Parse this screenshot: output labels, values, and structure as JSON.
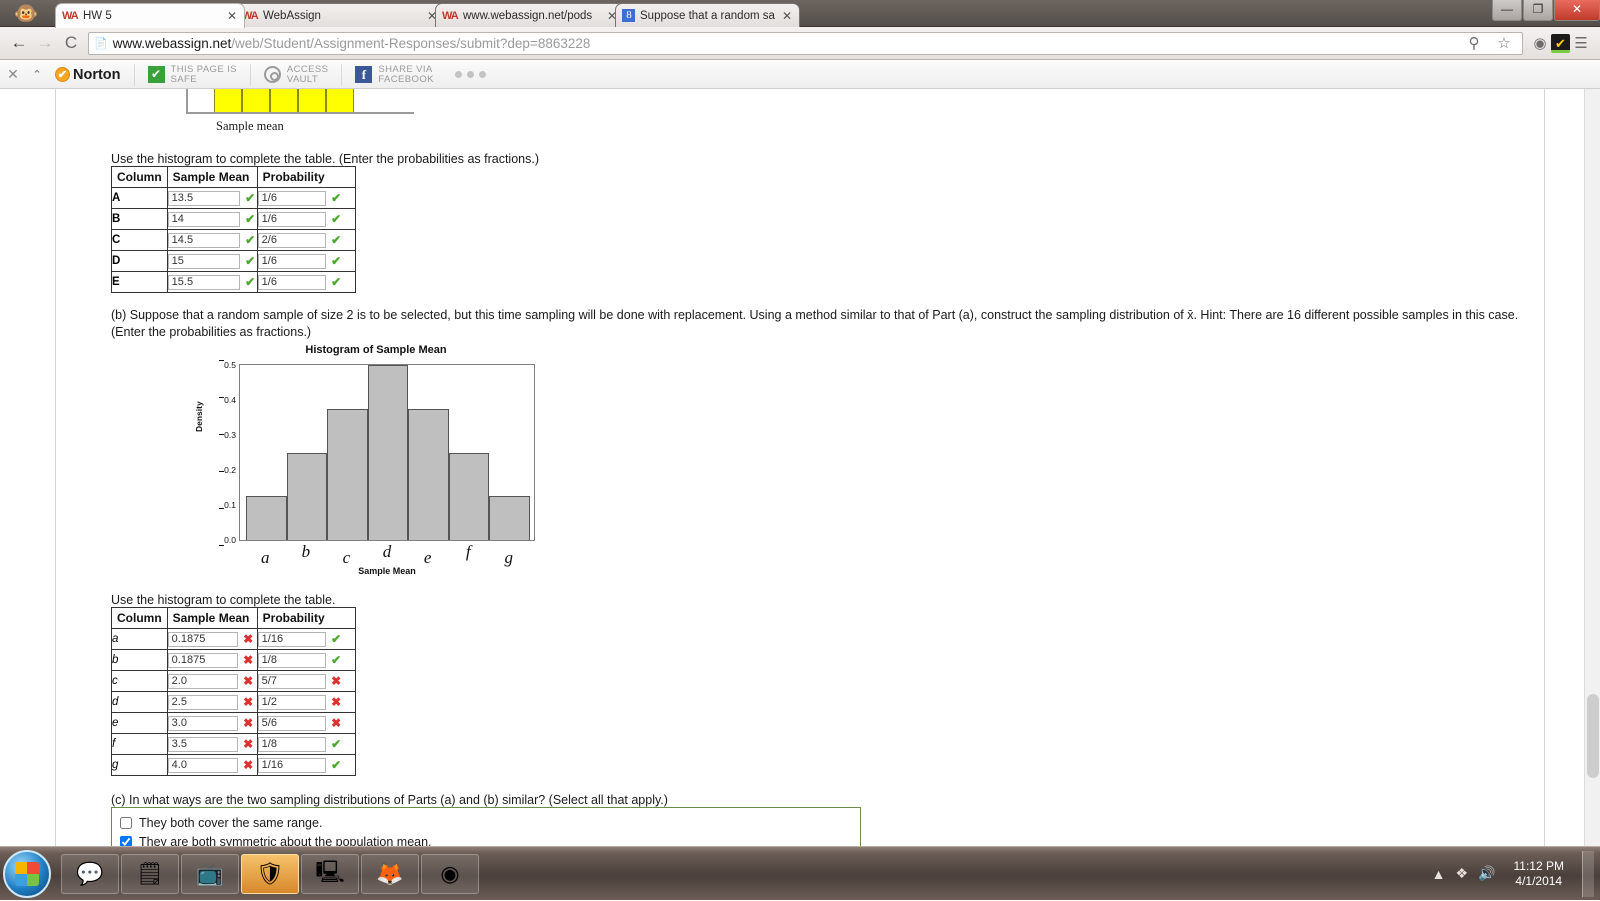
{
  "browser": {
    "logo_icon": "monkey-logo",
    "tabs": [
      {
        "title": "HW 5",
        "favicon": "webassign-icon",
        "active": true
      },
      {
        "title": "WebAssign",
        "favicon": "webassign-icon",
        "active": false
      },
      {
        "title": "www.webassign.net/pods",
        "favicon": "webassign-icon",
        "active": false
      },
      {
        "title": "Suppose that a random sa",
        "favicon": "google-icon",
        "active": false
      }
    ],
    "tab_close_label": "✕",
    "window_controls": {
      "minimize": "—",
      "maximize": "❐",
      "close": "✕"
    },
    "nav": {
      "back": "←",
      "forward": "→",
      "reload": "C"
    },
    "omnibox": {
      "page_icon": "page-icon",
      "url_domain": "www.webassign.net",
      "url_path": "/web/Student/Assignment-Responses/submit?dep=8863228"
    },
    "omnibox_icons": {
      "zoom": "⚲",
      "bookmark": "☆"
    },
    "toolbar_icons": {
      "extension": "◉",
      "norton_badge": "✔",
      "menu": "☰"
    }
  },
  "norton_bar": {
    "close_icon": "✕",
    "collapse_icon": "⌃",
    "brand": "Norton",
    "brand_check": "✔",
    "items": [
      {
        "icon": "green-check-icon",
        "glyph": "✔",
        "line1": "THIS PAGE IS",
        "line2": "SAFE"
      },
      {
        "icon": "vault-icon",
        "glyph": "",
        "line1": "ACCESS",
        "line2": "VAULT"
      },
      {
        "icon": "facebook-icon",
        "glyph": "f",
        "line1": "SHARE VIA",
        "line2": "FACEBOOK"
      }
    ]
  },
  "top_histogram": {
    "caption": "Sample mean",
    "bar_count": 5,
    "color": "#ffff00"
  },
  "part_a": {
    "instruction": "Use the histogram to complete the table. (Enter the probabilities as fractions.)",
    "headers": [
      "Column",
      "Sample Mean",
      "Probability"
    ],
    "rows": [
      {
        "column": "A",
        "sample_mean": "13.5",
        "mean_status": "correct",
        "probability": "1/6",
        "prob_status": "correct"
      },
      {
        "column": "B",
        "sample_mean": "14",
        "mean_status": "correct",
        "probability": "1/6",
        "prob_status": "correct"
      },
      {
        "column": "C",
        "sample_mean": "14.5",
        "mean_status": "correct",
        "probability": "2/6",
        "prob_status": "correct"
      },
      {
        "column": "D",
        "sample_mean": "15",
        "mean_status": "correct",
        "probability": "1/6",
        "prob_status": "correct"
      },
      {
        "column": "E",
        "sample_mean": "15.5",
        "mean_status": "correct",
        "probability": "1/6",
        "prob_status": "correct"
      }
    ]
  },
  "part_b": {
    "text": "(b) Suppose that a random sample of size 2 is to be selected, but this time sampling will be done with replacement. Using a method similar to that of Part (a), construct the sampling distribution of x̄. Hint: There are 16 different possible samples in this case. (Enter the probabilities as fractions.)",
    "instruction": "Use the histogram to complete the table.",
    "headers": [
      "Column",
      "Sample Mean",
      "Probability"
    ],
    "rows": [
      {
        "column": "a",
        "sample_mean": "0.1875",
        "mean_status": "incorrect",
        "probability": "1/16",
        "prob_status": "correct"
      },
      {
        "column": "b",
        "sample_mean": "0.1875",
        "mean_status": "incorrect",
        "probability": "1/8",
        "prob_status": "correct"
      },
      {
        "column": "c",
        "sample_mean": "2.0",
        "mean_status": "incorrect",
        "probability": "5/7",
        "prob_status": "incorrect"
      },
      {
        "column": "d",
        "sample_mean": "2.5",
        "mean_status": "incorrect",
        "probability": "1/2",
        "prob_status": "incorrect"
      },
      {
        "column": "e",
        "sample_mean": "3.0",
        "mean_status": "incorrect",
        "probability": "5/6",
        "prob_status": "incorrect"
      },
      {
        "column": "f",
        "sample_mean": "3.5",
        "mean_status": "incorrect",
        "probability": "1/8",
        "prob_status": "correct"
      },
      {
        "column": "g",
        "sample_mean": "4.0",
        "mean_status": "incorrect",
        "probability": "1/16",
        "prob_status": "correct"
      }
    ]
  },
  "part_c": {
    "text": "(c) In what ways are the two sampling distributions of Parts (a) and (b) similar? (Select all that apply.)",
    "options": [
      {
        "label": "They both cover the same range.",
        "checked": false
      },
      {
        "label": "They are both symmetric about the population mean.",
        "checked": true
      }
    ]
  },
  "marks": {
    "correct": "✔",
    "incorrect": "✖"
  },
  "chart_data": {
    "type": "bar",
    "title": "Histogram of Sample Mean",
    "xlabel": "Sample Mean",
    "ylabel": "Density",
    "categories": [
      "a",
      "b",
      "c",
      "d",
      "e",
      "f",
      "g"
    ],
    "values": [
      0.125,
      0.25,
      0.375,
      0.5,
      0.375,
      0.25,
      0.125
    ],
    "ylim": [
      0.0,
      0.5
    ],
    "yticks": [
      "0.0",
      "0.1",
      "0.2",
      "0.3",
      "0.4",
      "0.5"
    ],
    "ytick_values": [
      0.0,
      0.1,
      0.2,
      0.3,
      0.4,
      0.5
    ],
    "grid": false,
    "legend": false,
    "bar_color": "#bfbfbf",
    "bar_edge_color": "#555555"
  },
  "taskbar": {
    "start_label": "start-orb",
    "buttons": [
      {
        "name": "skype",
        "glyph": "💬",
        "active": false
      },
      {
        "name": "sticky-notes",
        "glyph": "🗒",
        "active": false
      },
      {
        "name": "media-player",
        "glyph": "📺",
        "active": false
      },
      {
        "name": "security-shield",
        "glyph": "🛡",
        "active": true
      },
      {
        "name": "calculator",
        "glyph": "🖳",
        "active": false
      },
      {
        "name": "firefox",
        "glyph": "🦊",
        "active": false
      },
      {
        "name": "chrome",
        "glyph": "◉",
        "active": false
      }
    ],
    "tray": {
      "expand": "▲",
      "dropbox": "❖",
      "volume": "🔊"
    },
    "time": "11:12 PM",
    "date": "4/1/2014"
  }
}
